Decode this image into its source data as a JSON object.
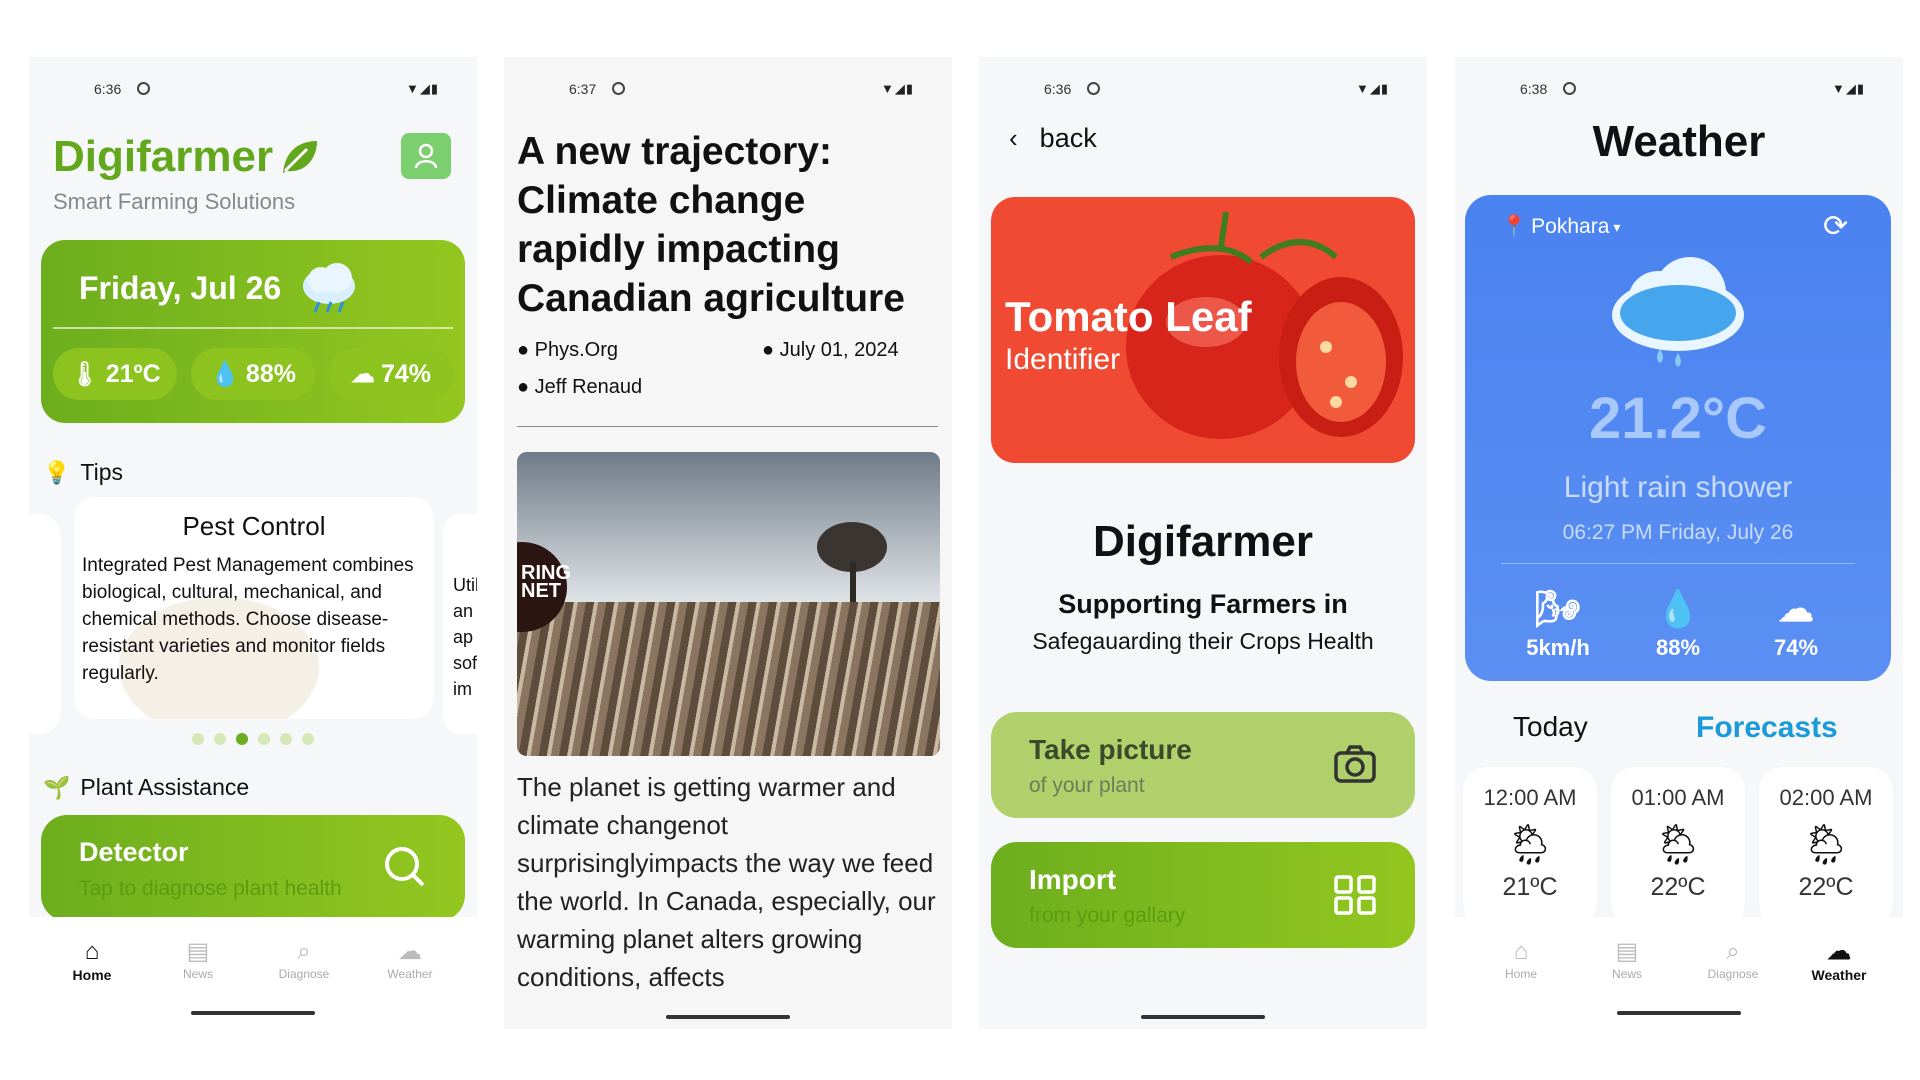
{
  "screens": [
    {
      "status": {
        "time": "6:36",
        "signal": "▼◢▮"
      },
      "app": {
        "name": "Digifarmer",
        "tagline": "Smart Farming Solutions",
        "leaf_icon": "leaf-icon",
        "profile_icon": "user-icon"
      },
      "today": {
        "date": "Friday, Jul 26",
        "weather_icon": "rain-cloud-icon",
        "temperature": "21ºC",
        "humidity": "88%",
        "cloud": "74%"
      },
      "tips": {
        "heading": "Tips",
        "card": {
          "title": "Pest Control",
          "body": "Integrated Pest Management combines biological, cultural, mechanical, and chemical methods. Choose disease-resistant varieties and monitor fields regularly."
        },
        "peek_lines": [
          "Util",
          "an",
          "ap",
          "sof",
          "im"
        ],
        "active_dot": 2,
        "dot_count": 6
      },
      "plant_assistance": {
        "heading": "Plant Assistance",
        "detector_title": "Detector",
        "detector_subtitle": "Tap to diagnose plant health"
      },
      "nav": [
        {
          "label": "Home",
          "icon": "home-icon",
          "active": true
        },
        {
          "label": "News",
          "icon": "news-icon",
          "active": false
        },
        {
          "label": "Diagnose",
          "icon": "search-icon",
          "active": false
        },
        {
          "label": "Weather",
          "icon": "cloud-icon",
          "active": false
        }
      ]
    },
    {
      "status": {
        "time": "6:37",
        "signal": "▼◢▮"
      },
      "article": {
        "title": "A new trajectory: Climate change rapidly impacting Canadian agriculture",
        "source": "Phys.Org",
        "date": "July 01, 2024",
        "author": "Jeff Renaud",
        "image_overlay": "RING NET",
        "body": "The planet is getting warmer and climate changenot surprisinglyimpacts the way we feed the world. In Canada, especially, our warming planet alters growing conditions, affects"
      }
    },
    {
      "status": {
        "time": "6:36",
        "signal": "▼◢▮"
      },
      "back_label": "back",
      "banner": {
        "title": "Tomato Leaf",
        "subtitle": "Identifier"
      },
      "brand": "Digifarmer",
      "headline": "Supporting Farmers in",
      "subheadline": "Safegauarding their Crops Health",
      "take_picture": {
        "title": "Take picture",
        "subtitle": "of your plant",
        "icon": "camera-icon"
      },
      "import": {
        "title": "Import",
        "subtitle": "from your gallary",
        "icon": "grid-icon"
      }
    },
    {
      "status": {
        "time": "6:38",
        "signal": "▼◢▮"
      },
      "title": "Weather",
      "location": "Pokhara",
      "temperature": "21.2°C",
      "condition": "Light rain shower",
      "datetime": "06:27 PM Friday, July 26",
      "stats": [
        {
          "value": "5km/h",
          "icon": "wind-icon"
        },
        {
          "value": "88%",
          "icon": "humidity-icon"
        },
        {
          "value": "74%",
          "icon": "cloud-icon"
        }
      ],
      "tabs": {
        "today": "Today",
        "forecasts": "Forecasts"
      },
      "hourly": [
        {
          "time": "12:00 AM",
          "temp": "21ºC",
          "icon": "rainbow-cloud-icon"
        },
        {
          "time": "01:00 AM",
          "temp": "22ºC",
          "icon": "rainbow-cloud-icon"
        },
        {
          "time": "02:00 AM",
          "temp": "22ºC",
          "icon": "rainbow-cloud-icon"
        }
      ],
      "nav": [
        {
          "label": "Home",
          "icon": "home-icon",
          "active": false
        },
        {
          "label": "News",
          "icon": "news-icon",
          "active": false
        },
        {
          "label": "Diagnose",
          "icon": "search-icon",
          "active": false
        },
        {
          "label": "Weather",
          "icon": "cloud-icon",
          "active": true
        }
      ]
    }
  ],
  "colors": {
    "brand_green": "#6dae1e",
    "light_green": "#afd06a",
    "weather_blue": "#4a82f0",
    "tomato_red": "#f04a32",
    "forecast_blue": "#1a9ad9"
  }
}
